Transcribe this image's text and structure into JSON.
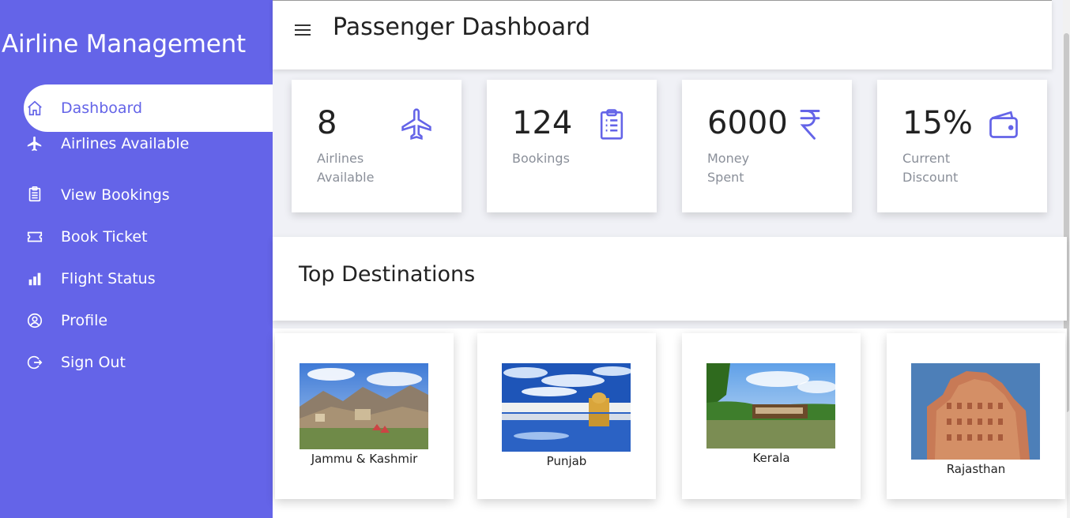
{
  "sidebar": {
    "brand": "Airline Management",
    "items": [
      {
        "label": "Dashboard",
        "icon": "home-icon",
        "active": true
      },
      {
        "label": "Airlines Available",
        "icon": "airplane-icon"
      },
      {
        "label": "View Bookings",
        "icon": "clipboard-icon"
      },
      {
        "label": "Book Ticket",
        "icon": "ticket-icon"
      },
      {
        "label": "Flight Status",
        "icon": "bar-chart-icon"
      },
      {
        "label": "Profile",
        "icon": "user-circle-icon"
      },
      {
        "label": "Sign Out",
        "icon": "sign-out-icon"
      }
    ]
  },
  "header": {
    "title": "Passenger Dashboard",
    "menu_icon": "hamburger-icon"
  },
  "stats": [
    {
      "value": "8",
      "label": "Airlines Available",
      "icon": "airplane-icon"
    },
    {
      "value": "124",
      "label": "Bookings",
      "icon": "clipboard-icon"
    },
    {
      "value": "6000",
      "label": "Money Spent",
      "icon": "rupee-icon"
    },
    {
      "value": "15%",
      "label": "Current Discount",
      "icon": "wallet-icon"
    }
  ],
  "destinations": {
    "title": "Top Destinations",
    "items": [
      {
        "name": "Jammu & Kashmir"
      },
      {
        "name": "Punjab"
      },
      {
        "name": "Kerala"
      },
      {
        "name": "Rajasthan"
      }
    ]
  },
  "colors": {
    "accent": "#6464e8",
    "background": "#f0f1f6",
    "muted_text": "#8a8f99"
  }
}
